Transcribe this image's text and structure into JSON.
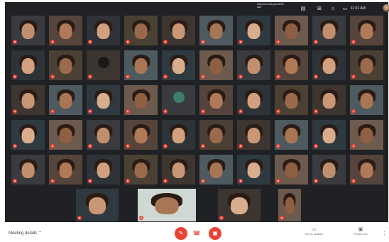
{
  "status": {
    "text": "Someone has joined the call",
    "clock": "11:21 AM"
  },
  "icons": {
    "captions": "cc-icon",
    "layout": "layout-icon",
    "people": "people-icon",
    "chat": "chat-icon",
    "mic": "mic-off-icon",
    "camera": "camera-off-icon",
    "hangup": "hangup-icon",
    "more": "more-vert-icon"
  },
  "participants": {
    "row1": [
      "",
      "",
      "",
      "",
      "",
      "",
      "",
      "",
      "",
      ""
    ],
    "row2": [
      "",
      "",
      "",
      "",
      "",
      "",
      "",
      "",
      "",
      ""
    ],
    "row3": [
      "",
      "",
      "",
      "",
      "",
      "",
      "",
      "",
      "",
      ""
    ],
    "row4": [
      "",
      "",
      "",
      "",
      "",
      "",
      "",
      "",
      "",
      ""
    ],
    "row5": [
      "",
      "",
      "",
      "",
      "",
      "",
      "",
      "",
      "",
      ""
    ],
    "row6": [
      "",
      "",
      "",
      "",
      "",
      "",
      ""
    ]
  },
  "letter_avatars": [
    {
      "letter": "",
      "color": "#1a1a1a"
    },
    {
      "letter": "",
      "color": "#3f7d6b"
    }
  ],
  "bottom": {
    "meeting_details": "Meeting details",
    "captions_label": "Turn on captions",
    "present_label": "Present now"
  },
  "colors": {
    "background": "#202124",
    "danger": "#ea4335",
    "tile": "#2b2c2f"
  }
}
